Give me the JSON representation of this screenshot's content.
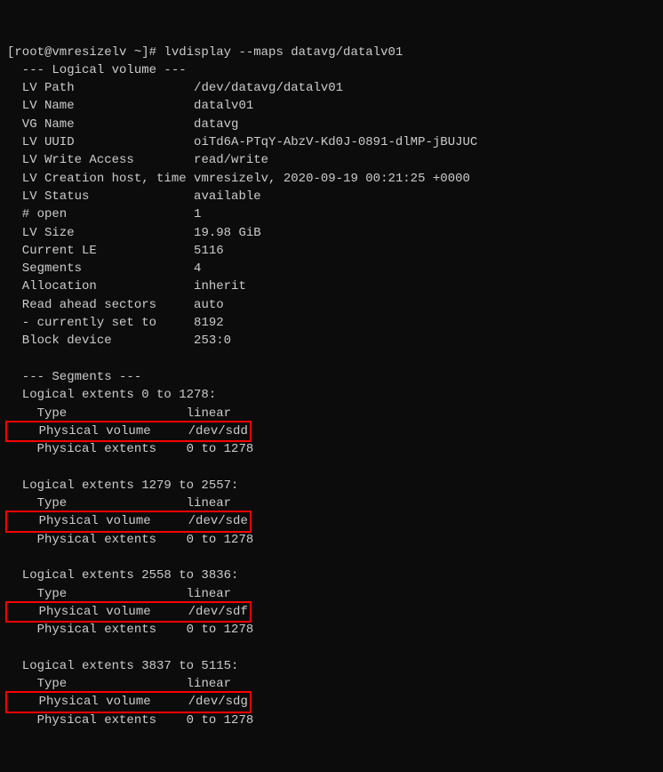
{
  "prompt": "[root@vmresizelv ~]# lvdisplay --maps datavg/datalv01",
  "lv_header": "  --- Logical volume ---",
  "fields": {
    "path_label": "  LV Path               ",
    "path_value": "/dev/datavg/datalv01",
    "name_label": "  LV Name               ",
    "name_value": "datalv01",
    "vg_label": "  VG Name               ",
    "vg_value": "datavg",
    "uuid_label": "  LV UUID               ",
    "uuid_value": "oiTd6A-PTqY-AbzV-Kd0J-0891-dlMP-jBUJUC",
    "wa_label": "  LV Write Access       ",
    "wa_value": "read/write",
    "ch_label": "  LV Creation host, time ",
    "ch_value": "vmresizelv, 2020-09-19 00:21:25 +0000",
    "status_label": "  LV Status             ",
    "status_value": "available",
    "open_label": "  # open                ",
    "open_value": "1",
    "size_label": "  LV Size               ",
    "size_value": "19.98 GiB",
    "le_label": "  Current LE            ",
    "le_value": "5116",
    "seg_label": "  Segments              ",
    "seg_value": "4",
    "alloc_label": "  Allocation            ",
    "alloc_value": "inherit",
    "rah_label": "  Read ahead sectors    ",
    "rah_value": "auto",
    "cset_label": "  - currently set to    ",
    "cset_value": "8192",
    "bd_label": "  Block device          ",
    "bd_value": "253:0"
  },
  "seg_header": "  --- Segments ---",
  "segments": [
    {
      "range": "  Logical extents 0 to 1278:",
      "type_label": "    Type               ",
      "type_value": "linear",
      "pv_label": "    Physical volume    ",
      "pv_value": "/dev/sdd",
      "pe_label": "    Physical extents   ",
      "pe_value": "0 to 1278"
    },
    {
      "range": "  Logical extents 1279 to 2557:",
      "type_label": "    Type               ",
      "type_value": "linear",
      "pv_label": "    Physical volume    ",
      "pv_value": "/dev/sde",
      "pe_label": "    Physical extents   ",
      "pe_value": "0 to 1278"
    },
    {
      "range": "  Logical extents 2558 to 3836:",
      "type_label": "    Type               ",
      "type_value": "linear",
      "pv_label": "    Physical volume    ",
      "pv_value": "/dev/sdf",
      "pe_label": "    Physical extents   ",
      "pe_value": "0 to 1278"
    },
    {
      "range": "  Logical extents 3837 to 5115:",
      "type_label": "    Type               ",
      "type_value": "linear",
      "pv_label": "    Physical volume    ",
      "pv_value": "/dev/sdg",
      "pe_label": "    Physical extents   ",
      "pe_value": "0 to 1278"
    }
  ]
}
